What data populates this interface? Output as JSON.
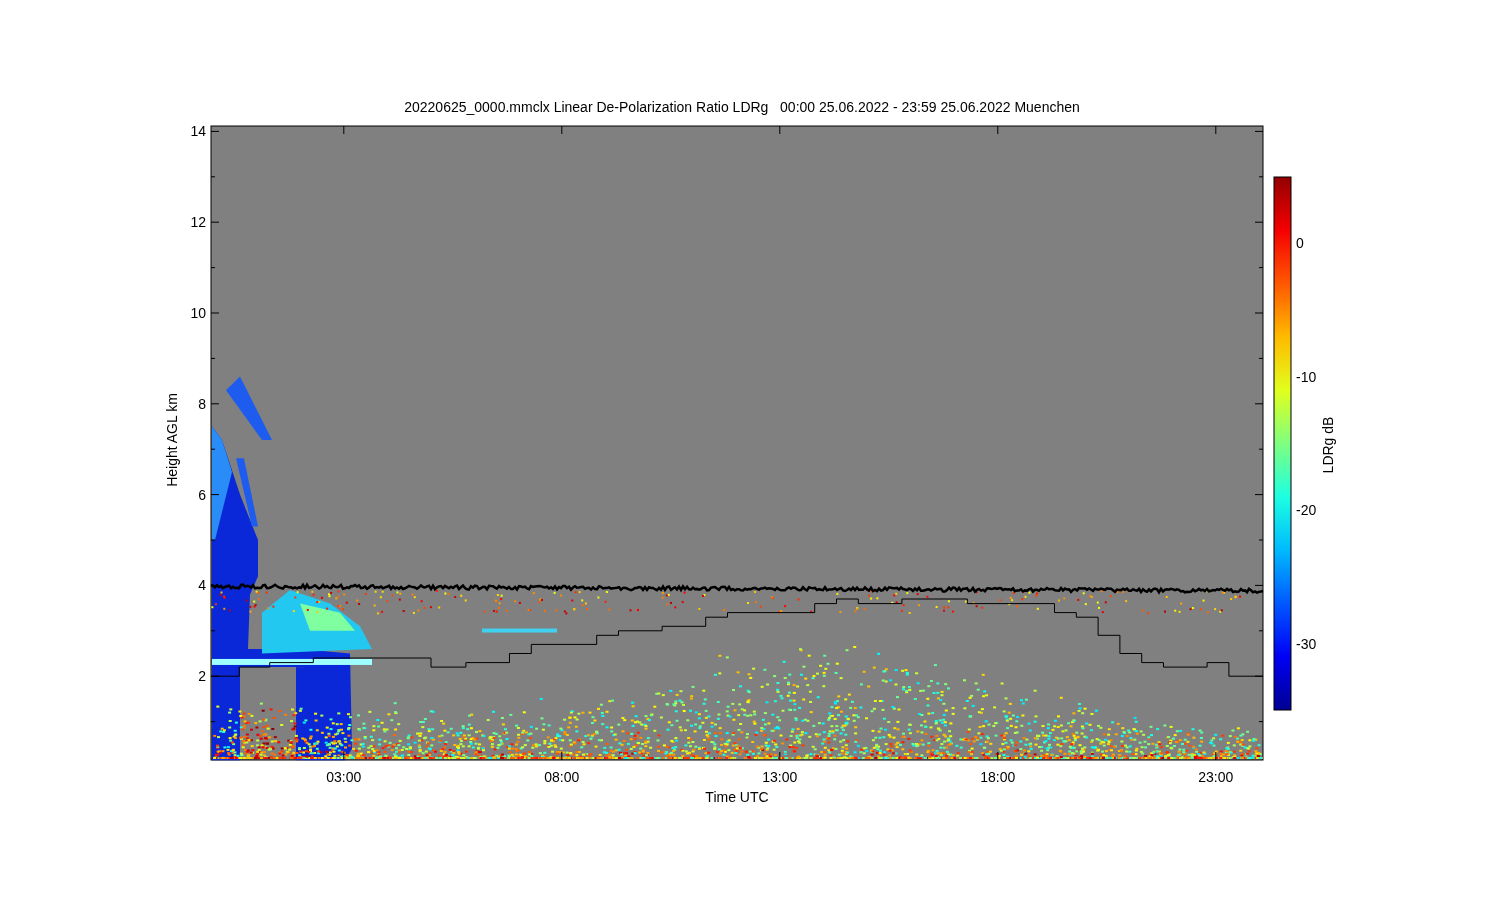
{
  "title": "20220625_0000.mmclx Linear De-Polarization Ratio LDRg   00:00 25.06.2022 - 23:59 25.06.2022 Muenchen",
  "plot": {
    "ylabel": "Height AGL km",
    "xlabel": "Time UTC",
    "yticks": [
      "14",
      "12",
      "10",
      "8",
      "6",
      "4",
      "2"
    ],
    "xticks": [
      "03:00",
      "08:00",
      "13:00",
      "18:00",
      "23:00"
    ]
  },
  "colorbar": {
    "label": "LDRg dB",
    "ticks": [
      "0",
      "-10",
      "-20",
      "-30"
    ]
  }
}
